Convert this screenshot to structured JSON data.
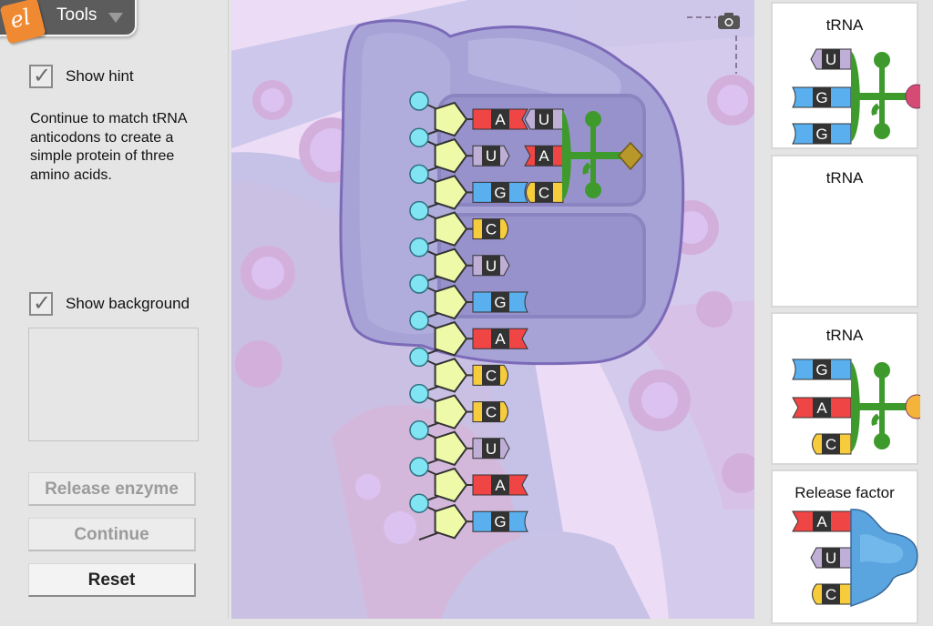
{
  "app": {
    "logo_text": "el",
    "tools_label": "Tools",
    "tools_icon": "triangle-down-icon"
  },
  "left_panel": {
    "show_hint": {
      "label": "Show hint",
      "checked": true,
      "check_glyph": "✓"
    },
    "hint_text": "Continue to match tRNA anticodons to create a simple protein of three amino acids.",
    "show_background": {
      "label": "Show background",
      "checked": true,
      "check_glyph": "✓"
    },
    "buttons": {
      "release_enzyme": {
        "label": "Release enzyme",
        "enabled": false
      },
      "continue": {
        "label": "Continue",
        "enabled": false
      },
      "reset": {
        "label": "Reset",
        "enabled": true
      }
    }
  },
  "simulation": {
    "camera_icon": "camera-icon",
    "mrna_codons": [
      "A",
      "U",
      "G",
      "C",
      "U",
      "G",
      "A",
      "C",
      "C",
      "U",
      "A",
      "G"
    ],
    "bound_trna": {
      "anticodon": [
        "U",
        "A",
        "C"
      ],
      "amino_acid_color": "#b8982a"
    },
    "base_colors": {
      "A": "#f04545",
      "U": "#bfaed6",
      "G": "#5ab0ee",
      "C": "#f6cc3c"
    },
    "sugar_color": "#eefaa8",
    "phosphate_color": "#80e4f2",
    "ribosome_color": "#a29dd4",
    "trna_color": "#3e9a2c"
  },
  "right_panel": {
    "cards": [
      {
        "title": "tRNA",
        "type": "trna",
        "anticodon": [
          "U",
          "G",
          "G"
        ],
        "amino_acid_color": "#d64b74",
        "empty": false
      },
      {
        "title": "tRNA",
        "type": "trna",
        "anticodon": [],
        "empty": true
      },
      {
        "title": "tRNA",
        "type": "trna",
        "anticodon": [
          "G",
          "A",
          "C"
        ],
        "amino_acid_color": "#f4b43c",
        "empty": false
      },
      {
        "title": "Release factor",
        "type": "release_factor",
        "anticodon": [
          "A",
          "U",
          "C"
        ],
        "empty": false
      }
    ]
  }
}
